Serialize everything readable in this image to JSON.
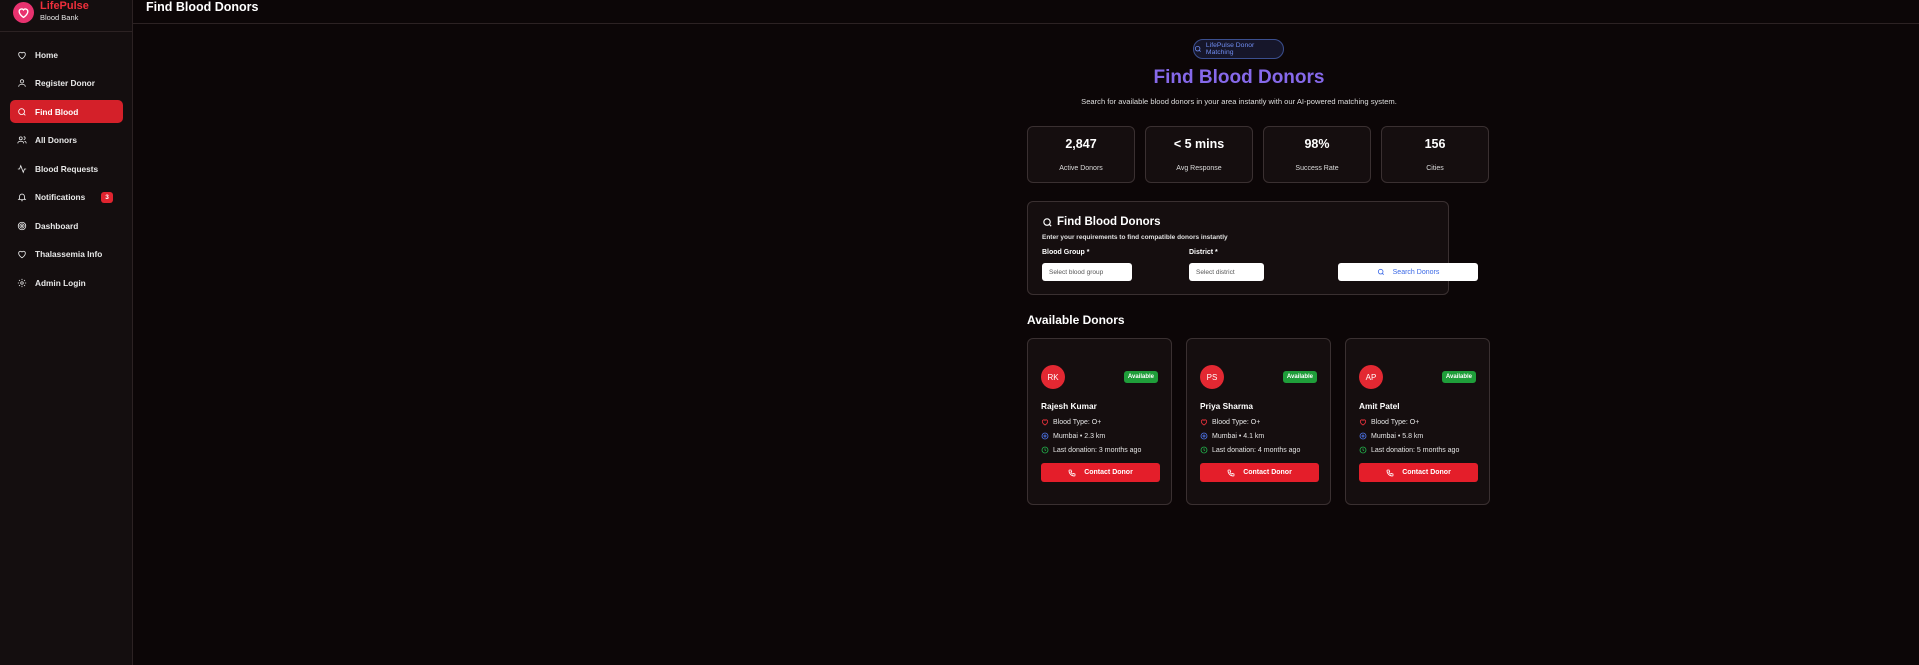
{
  "app": {
    "name": "LifePulse",
    "subtitle": "Blood Bank"
  },
  "sidebar": {
    "items": [
      {
        "label": "Home",
        "icon": "heart-icon"
      },
      {
        "label": "Register Donor",
        "icon": "user-icon"
      },
      {
        "label": "Find Blood",
        "icon": "search-icon",
        "active": true
      },
      {
        "label": "All Donors",
        "icon": "users-icon"
      },
      {
        "label": "Blood Requests",
        "icon": "activity-icon"
      },
      {
        "label": "Notifications",
        "icon": "bell-icon",
        "badge": "3"
      },
      {
        "label": "Dashboard",
        "icon": "target-icon"
      },
      {
        "label": "Thalassemia Info",
        "icon": "heart-icon"
      },
      {
        "label": "Admin Login",
        "icon": "gear-icon"
      }
    ]
  },
  "header": {
    "title": "Find Blood Donors"
  },
  "hero": {
    "pill": "LifePulse Donor Matching",
    "title": "Find Blood Donors",
    "subtitle": "Search for available blood donors in your area instantly with our AI-powered matching system."
  },
  "stats": [
    {
      "value": "2,847",
      "label": "Active Donors"
    },
    {
      "value": "< 5 mins",
      "label": "Avg Response"
    },
    {
      "value": "98%",
      "label": "Success Rate"
    },
    {
      "value": "156",
      "label": "Cities"
    }
  ],
  "search": {
    "title": "Find Blood Donors",
    "description": "Enter your requirements to find compatible donors instantly",
    "blood_group_label": "Blood Group *",
    "blood_group_placeholder": "Select blood group",
    "district_label": "District *",
    "district_placeholder": "Select district",
    "button": "Search Donors"
  },
  "donors_section": {
    "title": "Available Donors"
  },
  "donors": [
    {
      "initials": "RK",
      "status": "Available",
      "name": "Rajesh Kumar",
      "blood": "Blood Type: O+",
      "location": "Mumbai • 2.3 km",
      "last_donation": "Last donation: 3 months ago",
      "button": "Contact Donor"
    },
    {
      "initials": "PS",
      "status": "Available",
      "name": "Priya Sharma",
      "blood": "Blood Type: O+",
      "location": "Mumbai • 4.1 km",
      "last_donation": "Last donation: 4 months ago",
      "button": "Contact Donor"
    },
    {
      "initials": "AP",
      "status": "Available",
      "name": "Amit Patel",
      "blood": "Blood Type: O+",
      "location": "Mumbai • 5.8 km",
      "last_donation": "Last donation: 5 months ago",
      "button": "Contact Donor"
    }
  ],
  "colors": {
    "accent": "#d42029",
    "hero_title": "#8669ea",
    "available": "#1f9e3a",
    "link": "#3a68e6"
  }
}
